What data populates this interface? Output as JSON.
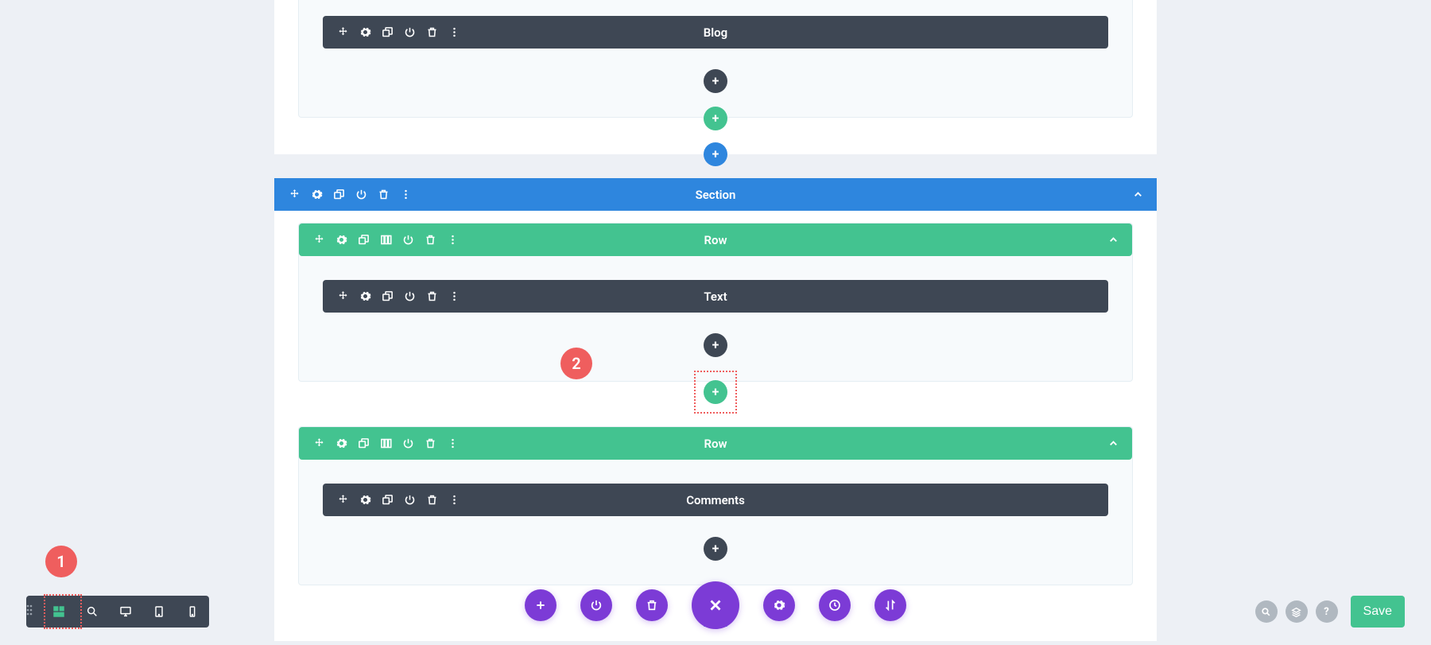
{
  "modules": {
    "blog": "Blog",
    "text": "Text",
    "comments": "Comments"
  },
  "rows": {
    "row": "Row"
  },
  "sections": {
    "section": "Section"
  },
  "bottom_bar": {
    "save": "Save"
  },
  "annotations": {
    "n1": "1",
    "n2": "2"
  }
}
